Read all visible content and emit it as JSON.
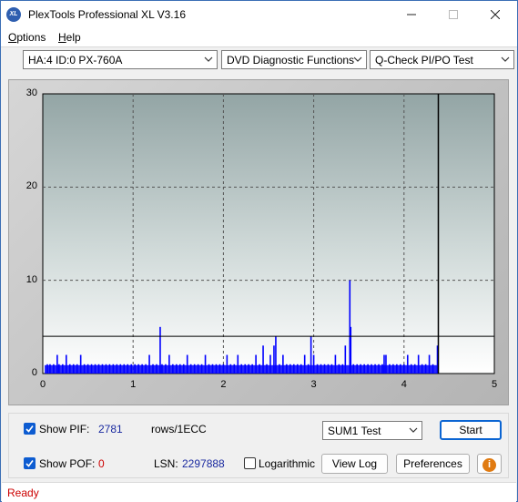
{
  "window": {
    "title": "PlexTools Professional XL V3.16",
    "icon_text": "XL"
  },
  "menu": {
    "items": [
      {
        "label": "Options"
      },
      {
        "label": "Help"
      }
    ]
  },
  "toolbar": {
    "drive": "HA:4 ID:0  PX-760A",
    "function": "DVD Diagnostic Functions",
    "test": "Q-Check PI/PO Test"
  },
  "chart_data": {
    "type": "bar",
    "title": "",
    "xlabel": "",
    "ylabel": "",
    "xlim": [
      0,
      5
    ],
    "ylim": [
      0,
      30
    ],
    "x_ticks": [
      "0",
      "1",
      "2",
      "3",
      "4",
      "5"
    ],
    "y_ticks": [
      "0",
      "10",
      "20",
      "30"
    ],
    "grid": true,
    "threshold": 4,
    "end_marker_x": 4.38,
    "series": [
      {
        "color": "#0000ff",
        "x": [
          0.05,
          0.08,
          0.12,
          0.16,
          0.18,
          0.22,
          0.26,
          0.3,
          0.34,
          0.38,
          0.42,
          0.46,
          0.5,
          0.54,
          0.58,
          0.62,
          0.66,
          0.7,
          0.74,
          0.78,
          0.82,
          0.86,
          0.9,
          0.94,
          0.98,
          1.02,
          1.06,
          1.1,
          1.14,
          1.18,
          1.22,
          1.26,
          1.3,
          1.32,
          1.36,
          1.4,
          1.44,
          1.48,
          1.52,
          1.56,
          1.6,
          1.64,
          1.68,
          1.72,
          1.76,
          1.8,
          1.84,
          1.88,
          1.92,
          1.96,
          2.0,
          2.04,
          2.08,
          2.12,
          2.16,
          2.2,
          2.24,
          2.28,
          2.32,
          2.36,
          2.4,
          2.44,
          2.48,
          2.52,
          2.56,
          2.58,
          2.62,
          2.66,
          2.7,
          2.74,
          2.78,
          2.82,
          2.86,
          2.9,
          2.94,
          2.97,
          3.0,
          3.04,
          3.08,
          3.12,
          3.16,
          3.2,
          3.24,
          3.28,
          3.32,
          3.35,
          3.4,
          3.41,
          3.44,
          3.48,
          3.52,
          3.56,
          3.6,
          3.64,
          3.68,
          3.72,
          3.76,
          3.78,
          3.8,
          3.84,
          3.88,
          3.92,
          3.96,
          4.0,
          4.04,
          4.08,
          4.12,
          4.16,
          4.2,
          4.24,
          4.28,
          4.32,
          4.37
        ],
        "values": [
          1,
          1,
          1,
          2,
          1,
          1,
          2,
          1,
          1,
          1,
          2,
          1,
          1,
          1,
          1,
          1,
          1,
          1,
          1,
          1,
          1,
          1,
          1,
          1,
          1,
          1,
          1,
          1,
          1,
          2,
          1,
          1,
          5,
          1,
          1,
          2,
          1,
          1,
          1,
          1,
          2,
          1,
          1,
          1,
          1,
          2,
          1,
          1,
          1,
          1,
          1,
          2,
          1,
          1,
          2,
          1,
          1,
          1,
          1,
          2,
          1,
          3,
          1,
          2,
          3,
          4,
          1,
          2,
          1,
          1,
          1,
          1,
          1,
          2,
          1,
          4,
          2,
          1,
          1,
          1,
          1,
          1,
          2,
          1,
          1,
          3,
          10,
          5,
          1,
          1,
          1,
          1,
          1,
          1,
          1,
          1,
          1,
          2,
          2,
          1,
          1,
          1,
          1,
          1,
          2,
          1,
          1,
          2,
          1,
          1,
          2,
          1,
          3
        ]
      }
    ]
  },
  "controls": {
    "show_pif_label": "Show PIF:",
    "pif_value": "2781",
    "rows_label": "rows/1ECC",
    "show_pof_label": "Show POF:",
    "pof_value": "0",
    "lsn_label": "LSN:",
    "lsn_value": "2297888",
    "logarithmic_label": "Logarithmic",
    "sum_select": "SUM1 Test",
    "start_label": "Start",
    "view_log_label": "View Log",
    "preferences_label": "Preferences",
    "info_icon_text": "i",
    "show_pif_checked": true,
    "show_pof_checked": true,
    "logarithmic_checked": false
  },
  "status": {
    "text": "Ready"
  }
}
